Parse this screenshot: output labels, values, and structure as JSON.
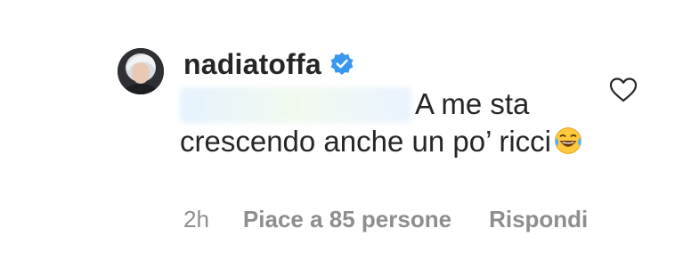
{
  "comment": {
    "username": "nadiatoffa",
    "verified": true,
    "text": "A me sta crescendo anche un po’ ricci",
    "emoji": "face-with-tears-of-joy",
    "liked": false
  },
  "meta": {
    "time": "2h",
    "likes": "Piace a 85 persone",
    "reply": "Rispondi"
  },
  "colors": {
    "text": "#262626",
    "muted": "#8e8e8e",
    "verified": "#3897f0"
  }
}
